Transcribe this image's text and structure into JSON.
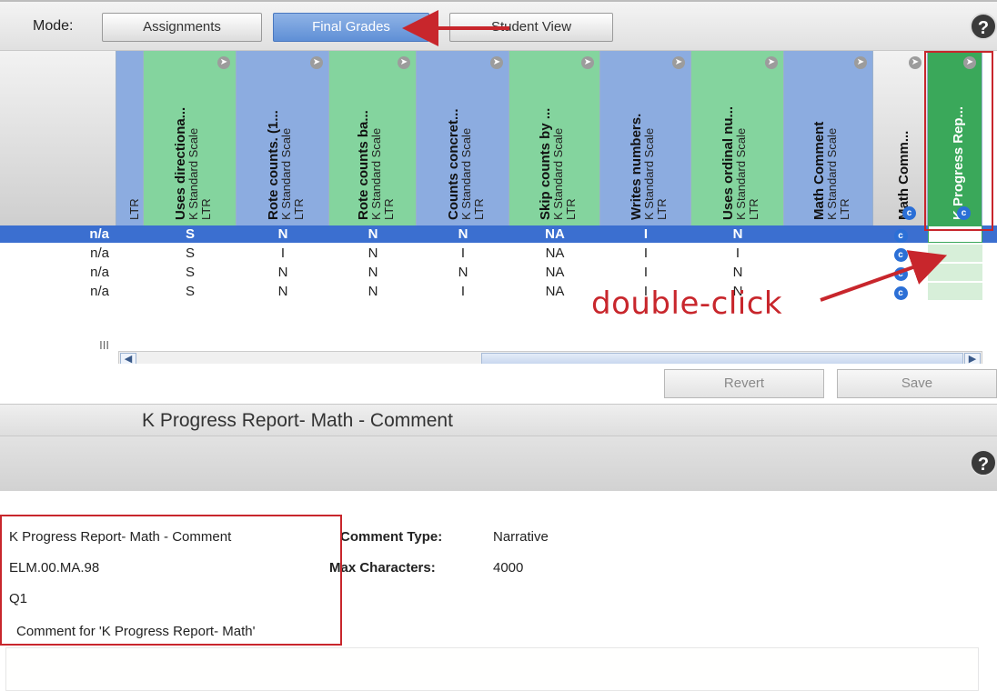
{
  "toolbar": {
    "mode_label": "Mode:",
    "modes": [
      "Assignments",
      "Final Grades",
      "Student View"
    ],
    "active_mode": "Final Grades"
  },
  "grid": {
    "columns": [
      {
        "title": "",
        "sub1": "",
        "sub2": "LTR",
        "color": "blue"
      },
      {
        "title": "Uses directiona...",
        "sub1": "K Standard Scale",
        "sub2": "LTR",
        "color": "green"
      },
      {
        "title": "Rote counts. (1...",
        "sub1": "K Standard Scale",
        "sub2": "LTR",
        "color": "blue"
      },
      {
        "title": "Rote counts ba...",
        "sub1": "K Standard Scale",
        "sub2": "LTR",
        "color": "green"
      },
      {
        "title": "Counts concret...",
        "sub1": "K Standard Scale",
        "sub2": "LTR",
        "color": "blue"
      },
      {
        "title": "Skip counts by ...",
        "sub1": "K Standard Scale",
        "sub2": "LTR",
        "color": "green"
      },
      {
        "title": "Writes numbers.",
        "sub1": "K Standard Scale",
        "sub2": "LTR",
        "color": "blue"
      },
      {
        "title": "Uses ordinal nu...",
        "sub1": "K Standard Scale",
        "sub2": "LTR",
        "color": "green"
      },
      {
        "title": "Math Comment",
        "sub1": "K Standard Scale",
        "sub2": "LTR",
        "color": "blue"
      },
      {
        "title": "Math Comm...",
        "sub1": "",
        "sub2": "",
        "color": "gray"
      },
      {
        "title": "K Progress Rep...",
        "sub1": "",
        "sub2": "",
        "color": "sel"
      }
    ],
    "rows": [
      {
        "first": "n/a",
        "cells": [
          "",
          "S",
          "N",
          "N",
          "N",
          "NA",
          "I",
          "N",
          "",
          "c",
          ""
        ],
        "selected": true
      },
      {
        "first": "n/a",
        "cells": [
          "",
          "S",
          "I",
          "N",
          "I",
          "NA",
          "I",
          "I",
          "",
          "c",
          ""
        ],
        "selected": false
      },
      {
        "first": "n/a",
        "cells": [
          "",
          "S",
          "N",
          "N",
          "N",
          "NA",
          "I",
          "N",
          "",
          "c",
          ""
        ],
        "selected": false
      },
      {
        "first": "n/a",
        "cells": [
          "",
          "S",
          "N",
          "N",
          "I",
          "NA",
          "I",
          "N",
          "",
          "c",
          ""
        ],
        "selected": false
      }
    ],
    "scroll_label": "III"
  },
  "actions": {
    "revert": "Revert",
    "save": "Save"
  },
  "panel": {
    "title": "K Progress Report- Math - Comment",
    "left": [
      "K Progress Report- Math - Comment",
      "ELM.00.MA.98",
      "Q1",
      "Comment for 'K Progress Report- Math'"
    ],
    "comment_type_label": "Comment Type:",
    "comment_type_value": "Narrative",
    "max_chars_label": "Max Characters:",
    "max_chars_value": "4000"
  },
  "annotation": {
    "text": "double-click",
    "color": "#c8262c"
  },
  "icons": {
    "help": "?",
    "c": "c"
  }
}
